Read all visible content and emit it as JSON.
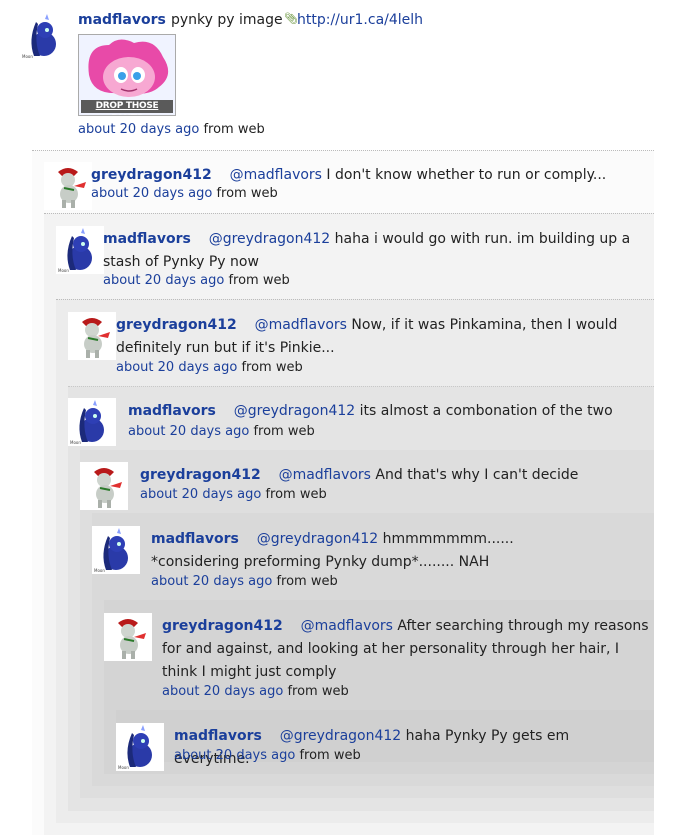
{
  "root": {
    "author": "madflavors",
    "text": "pynky py image",
    "link": "http://ur1.ca/4lelh",
    "image_caption": "DROP THOSE PANTS",
    "time": "about 20 days ago",
    "source": "from web"
  },
  "replies": [
    {
      "author": "greydragon412",
      "mention": "@madflavors",
      "text": " I don't know whether to run or comply...",
      "time": "about 20 days ago",
      "source": "from web"
    },
    {
      "author": "madflavors",
      "mention": "@greydragon412",
      "text": " haha i would go with run. im building up a stash of Pynky Py now",
      "time": "about 20 days ago",
      "source": "from web"
    },
    {
      "author": "greydragon412",
      "mention": "@madflavors",
      "text": " Now, if it was Pinkamina, then I would definitely run but if it's Pinkie...",
      "time": "about 20 days ago",
      "source": "from web"
    },
    {
      "author": "madflavors",
      "mention": "@greydragon412",
      "text": " its almost a combonation of the two",
      "time": "about 20 days ago",
      "source": "from web"
    },
    {
      "author": "greydragon412",
      "mention": "@madflavors",
      "text": " And that's why I can't decide",
      "time": "about 20 days ago",
      "source": "from web"
    },
    {
      "author": "madflavors",
      "mention": "@greydragon412",
      "text": " hmmmmmmm...... *considering preforming Pynky dump*........ NAH",
      "time": "about 20 days ago",
      "source": "from web"
    },
    {
      "author": "greydragon412",
      "mention": "@madflavors",
      "text": " After searching through my reasons for and against, and looking at her personality through her hair, I think I might just comply",
      "time": "about 20 days ago",
      "source": "from web"
    },
    {
      "author": "madflavors",
      "mention": "@greydragon412",
      "text": " haha Pynky Py gets em everytime.",
      "time": "about 20 days ago",
      "source": "from web"
    }
  ],
  "colors": {
    "link": "#1b3f9b",
    "text": "#222222"
  },
  "icons": {
    "link": "paperclip-icon"
  }
}
